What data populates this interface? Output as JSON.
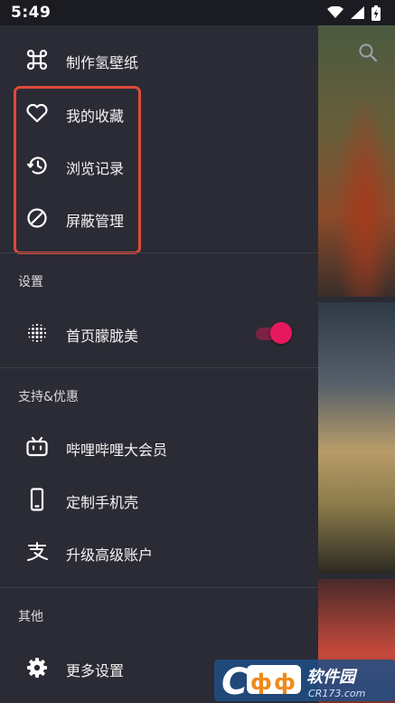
{
  "status_bar": {
    "time": "5:49"
  },
  "drawer": {
    "top_items": [
      {
        "label": "制作氢壁纸",
        "icon": "command-icon"
      },
      {
        "label": "我的收藏",
        "icon": "heart-icon"
      },
      {
        "label": "浏览记录",
        "icon": "history-icon"
      },
      {
        "label": "屏蔽管理",
        "icon": "block-icon"
      }
    ],
    "settings": {
      "header": "设置",
      "blur_toggle": {
        "label": "首页朦胧美",
        "on": true
      }
    },
    "support": {
      "header": "支持&优惠",
      "items": [
        {
          "label": "哔哩哔哩大会员",
          "icon": "bilibili-icon"
        },
        {
          "label": "定制手机壳",
          "icon": "phone-icon"
        },
        {
          "label": "升级高级账户",
          "icon": "alipay-icon"
        }
      ]
    },
    "other": {
      "header": "其他",
      "items": [
        {
          "label": "更多设置",
          "icon": "gear-icon"
        }
      ]
    }
  },
  "watermark": {
    "brand": "软件园",
    "domain": "CR173.com"
  },
  "colors": {
    "drawer_bg": "#2b2b35",
    "highlight": "#e04a3a",
    "toggle_accent": "#e8185e"
  }
}
